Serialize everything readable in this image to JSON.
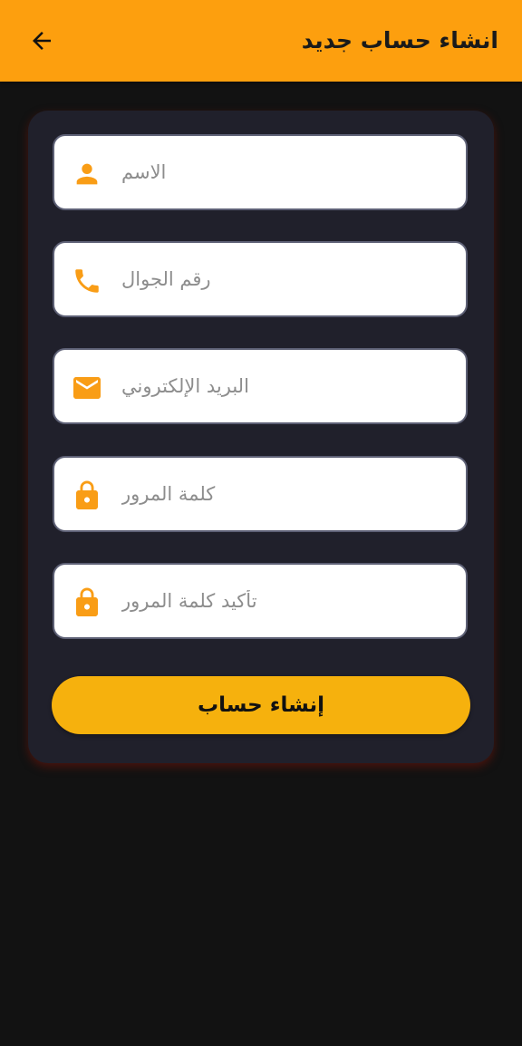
{
  "appbar": {
    "title": "انشاء حساب جديد",
    "back_icon": "arrow-back-icon"
  },
  "form": {
    "fields": [
      {
        "placeholder": "الاسم",
        "icon": "person-icon",
        "value": ""
      },
      {
        "placeholder": "رقم الجوال",
        "icon": "phone-icon",
        "value": ""
      },
      {
        "placeholder": "البريد الإلكتروني",
        "icon": "email-icon",
        "value": ""
      },
      {
        "placeholder": "كلمة المرور",
        "icon": "lock-icon",
        "value": ""
      },
      {
        "placeholder": "تأكيد كلمة المرور",
        "icon": "lock-icon",
        "value": ""
      }
    ],
    "submit_label": "إنشاء حساب"
  },
  "colors": {
    "appbar": "#fd9f0e",
    "background": "#121212",
    "card": "#20202b",
    "accent_icon": "#f99d16",
    "button": "#f6b10d"
  }
}
